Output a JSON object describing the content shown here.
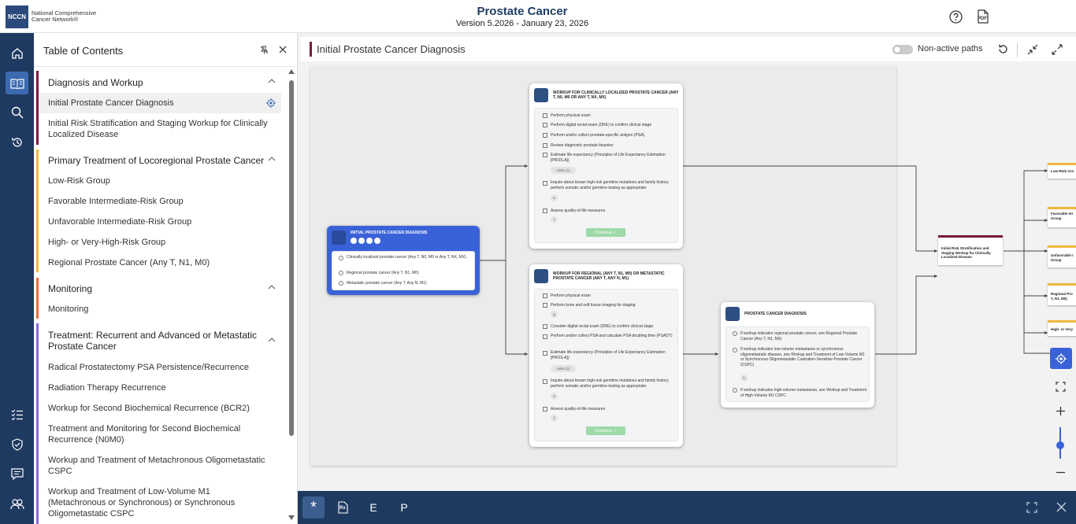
{
  "header": {
    "logo_text": "NCCN",
    "org_line1": "National Comprehensive",
    "org_line2": "Cancer Network®",
    "title": "Prostate Cancer",
    "version": "Version 5.2026 - January 23, 2026",
    "pdf_label": "PDF"
  },
  "rail": {
    "icons": [
      "home-icon",
      "book-icon",
      "search-icon",
      "history-icon",
      "checklist-icon",
      "shield-icon",
      "feedback-icon",
      "users-icon"
    ]
  },
  "toc": {
    "title": "Table of Contents",
    "sections": [
      {
        "title": "Diagnosis and Workup",
        "color": "#7a1a3d",
        "items": [
          "Initial Prostate Cancer Diagnosis",
          "Initial Risk Stratification and Staging Workup for Clinically Localized Disease"
        ]
      },
      {
        "title": "Primary Treatment of Locoregional Prostate Cancer",
        "color": "#f0b840",
        "items": [
          "Low-Risk Group",
          "Favorable Intermediate-Risk Group",
          "Unfavorable Intermediate-Risk Group",
          "High- or Very-High-Risk Group",
          "Regional Prostate Cancer (Any T, N1, M0)"
        ]
      },
      {
        "title": "Monitoring",
        "color": "#e8703a",
        "items": [
          "Monitoring"
        ]
      },
      {
        "title": "Treatment: Recurrent and Advanced or Metastatic Prostate Cancer",
        "color": "#8a6ad8",
        "items": [
          "Radical Prostatectomy PSA Persistence/Recurrence",
          "Radiation Therapy Recurrence",
          "Workup for Second Biochemical Recurrence (BCR2)",
          "Treatment and Monitoring for Second Biochemical Recurrence (N0M0)",
          "Workup and Treatment of Metachronous Oligometastatic CSPC",
          "Workup and Treatment of Low-Volume M1 (Metachronous or Synchronous) or Synchronous Oligometastatic CSPC"
        ]
      }
    ]
  },
  "pathbar": {
    "title": "Initial Prostate Cancer Diagnosis",
    "toggle_label": "Non-active paths"
  },
  "flow": {
    "initial": {
      "title": "Initial Prostate Cancer Diagnosis",
      "options": [
        "Clinically localized prostate cancer (Any T, N0, M0 or Any T, NX, MX)",
        "Regional prostate cancer (Any T, N1, M0)",
        "Metastatic prostate cancer (Any T, Any N, M1)"
      ]
    },
    "workup_local": {
      "title": "Workup for Clinically Localized Prostate Cancer (Any T, N0, M0 or Any T, NX, MX)",
      "items": [
        "Perform physical exam",
        "Perform digital rectal exam (DRE) to confirm clinical stage",
        "Perform and/or collect prostate-specific antigen (PSA)",
        "Review diagnostic prostate biopsies",
        "Estimate life expectancy (Principles of Life Expectancy Estimation [PROS-A])",
        "Inquire about known high-risk germline mutations and family history; perform somatic and/or germline testing as appropriate",
        "Assess quality-of-life measures"
      ],
      "links": "Links (1)",
      "note_e": "e",
      "note_f": "f",
      "continue": "Continue"
    },
    "workup_regional": {
      "title": "Workup for Regional (Any T, N1, M0) or Metastatic Prostate Cancer (Any T, Any N, M1)",
      "items": [
        "Perform physical exam",
        "Perform bone and soft tissue imaging for staging",
        "Consider digital rectal exam (DRE) to confirm clinical stage",
        "Perform and/or collect PSA and calculate PSA doubling time (PSADT)",
        "Estimate life expectancy (Principles of Life Expectancy Estimation [PROS-A])",
        "Inquire about known high-risk germline mutations and family history; perform somatic and/or germline testing as appropriate",
        "Assess quality-of-life measures"
      ],
      "note_g": "g",
      "links": "Links (1)",
      "note_e": "e",
      "note_f": "f",
      "continue": "Continue"
    },
    "diagnosis": {
      "title": "Prostate Cancer Diagnosis",
      "options": [
        "If workup indicates regional prostate cancer, see Regional Prostate Cancer (Any T, N1, M0)",
        "If workup indicates low-volume metastases or synchronous oligometastatic disease, see Workup and Treatment of Low-Volume M1 or Synchronous Oligometastatic Castration-Sensitive Prostate Cancer (CSPC)",
        "If workup indicates high-volume metastases, see Workup and Treatment of High-Volume M1 CSPC"
      ],
      "note_h": "h"
    },
    "risk_node": "Initial Risk Stratification and Staging Workup for Clinically Localized Disease",
    "right_nodes": [
      "Low-Risk Gro",
      "Favorable Int Group",
      "Unfavorable I Group",
      "Regional Pro T, N1, M0)",
      "High- or Very"
    ]
  },
  "bottombar": {
    "buttons": [
      "*",
      "Rx",
      "E",
      "P"
    ]
  }
}
